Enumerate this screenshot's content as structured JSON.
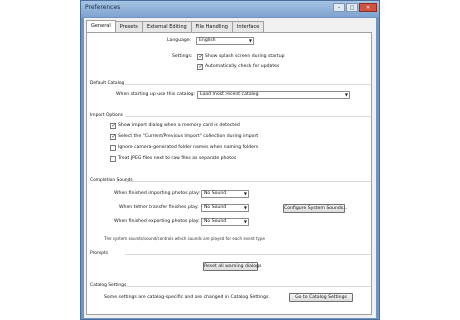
{
  "window": {
    "title": "Preferences",
    "minimize": "–",
    "maximize": "□",
    "close": "✕"
  },
  "tabs": [
    {
      "label": "General"
    },
    {
      "label": "Presets"
    },
    {
      "label": "External Editing"
    },
    {
      "label": "File Handling"
    },
    {
      "label": "Interface"
    }
  ],
  "general": {
    "language_label": "Language:",
    "language_value": "English",
    "settings_label": "Settings:",
    "show_splash": "Show splash screen during startup",
    "auto_check": "Automatically check for updates"
  },
  "default_catalog": {
    "heading": "Default Catalog",
    "label": "When starting up use this catalog:",
    "value": "Load most recent catalog"
  },
  "import_options": {
    "heading": "Import Options",
    "opt1": "Show import dialog when a memory card is detected",
    "opt2": "Select the \"Current/Previous Import\" collection during import",
    "opt3": "Ignore camera-generated folder names when naming folders",
    "opt4": "Treat JPEG files next to raw files as separate photos"
  },
  "completion_sounds": {
    "heading": "Completion Sounds",
    "import_label": "When finished importing photos play:",
    "import_value": "No Sound",
    "tether_label": "When tether transfer finishes play:",
    "tether_value": "No Sound",
    "export_label": "When finished exporting photos play:",
    "export_value": "No Sound",
    "configure_button": "Configure System Sounds...",
    "note": "The system sounds/sound/controls which sounds are played for each event type"
  },
  "prompts": {
    "heading": "Prompts",
    "reset_button": "Reset all warning dialogs"
  },
  "catalog_settings": {
    "heading": "Catalog Settings",
    "text": "Some settings are catalog-specific and are changed in Catalog Settings.",
    "button": "Go to Catalog Settings"
  },
  "icons": {
    "check": "check-mark-icon",
    "dropdown": "chevron-down-icon"
  },
  "colors": {
    "frame": "#6f95c0",
    "panel": "#ffffff",
    "dialog": "#f0f0f0"
  }
}
